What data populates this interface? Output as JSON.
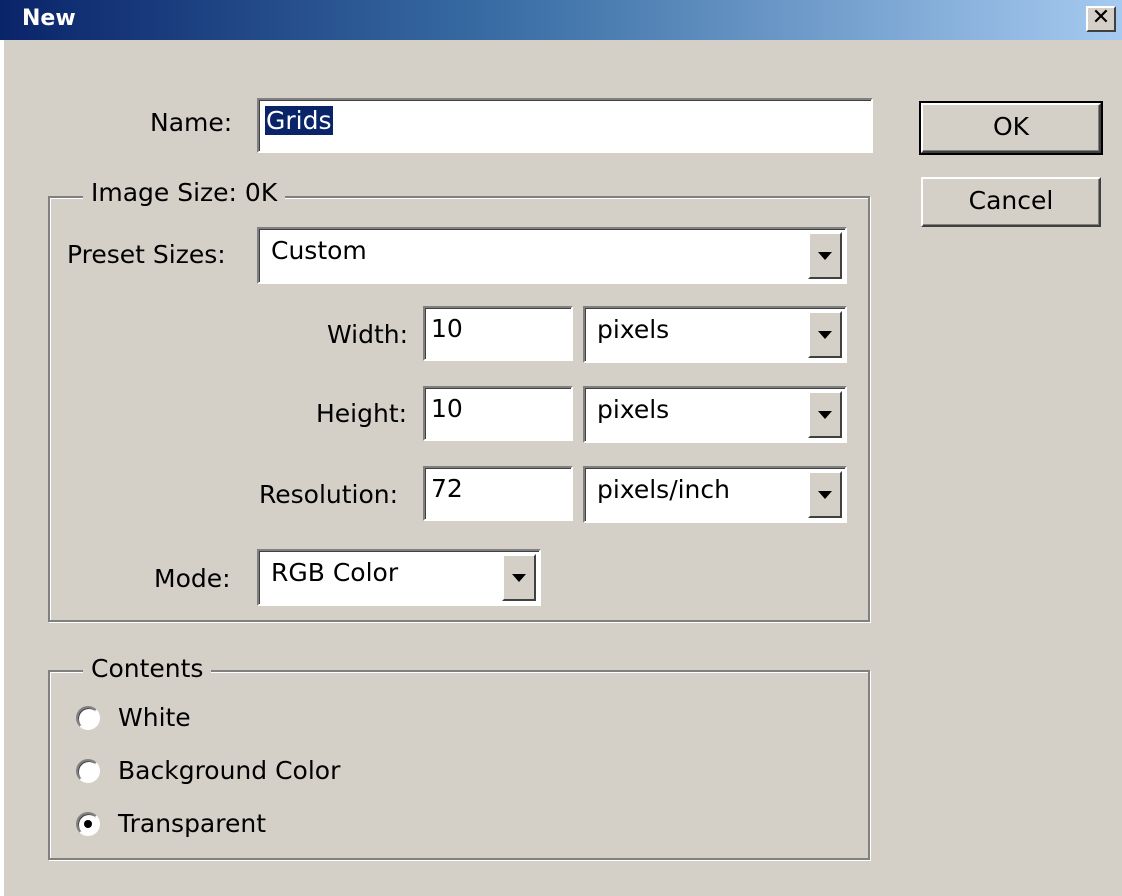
{
  "window": {
    "title": "New",
    "close_glyph": "✕"
  },
  "name_field": {
    "label": "Name:",
    "value": "Grids"
  },
  "image_size": {
    "legend": "Image Size: 0K",
    "preset": {
      "label": "Preset Sizes:",
      "value": "Custom"
    },
    "width": {
      "label": "Width:",
      "value": "10",
      "unit": "pixels"
    },
    "height": {
      "label": "Height:",
      "value": "10",
      "unit": "pixels"
    },
    "resolution": {
      "label": "Resolution:",
      "value": "72",
      "unit": "pixels/inch"
    },
    "mode": {
      "label": "Mode:",
      "value": "RGB Color"
    }
  },
  "contents": {
    "legend": "Contents",
    "options": [
      {
        "label": "White",
        "checked": false
      },
      {
        "label": "Background Color",
        "checked": false
      },
      {
        "label": "Transparent",
        "checked": true
      }
    ]
  },
  "buttons": {
    "ok": "OK",
    "cancel": "Cancel"
  },
  "colors": {
    "face": "#d4d0c8",
    "titlebar_start": "#0a246a",
    "titlebar_end": "#a6caf0",
    "selection": "#0a246a"
  }
}
